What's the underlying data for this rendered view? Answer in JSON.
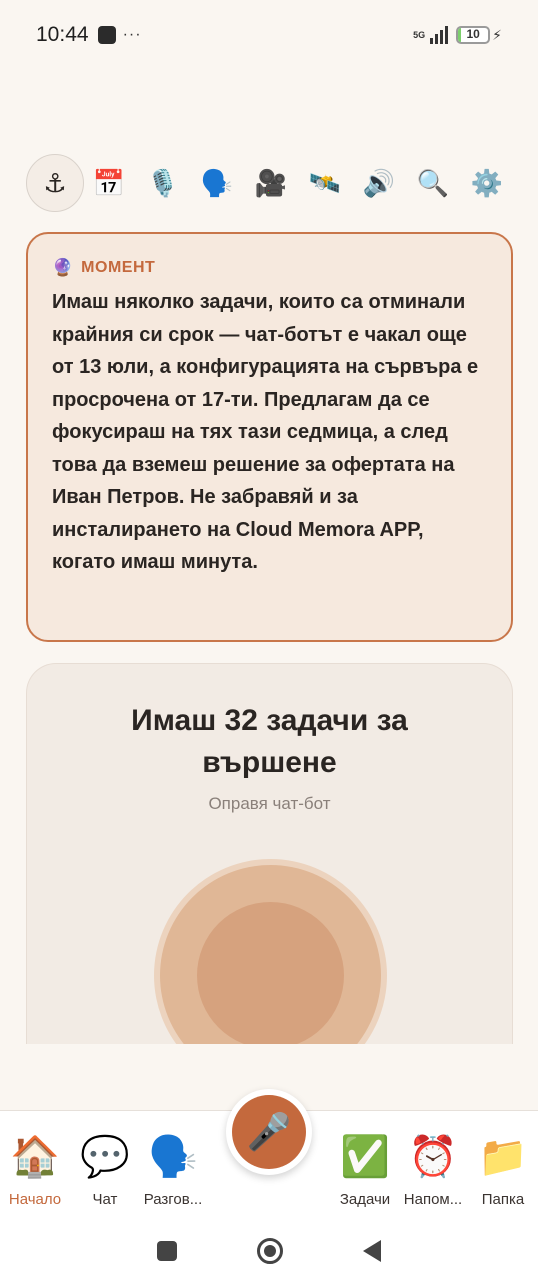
{
  "status_bar": {
    "time": "10:44",
    "dots": "···",
    "network": "5G",
    "battery": "10",
    "battery_level_percent": 10
  },
  "toolbar": {
    "icons": [
      {
        "name": "anchor-icon",
        "glyph": "⚓"
      },
      {
        "name": "calendar-icon",
        "glyph": "📅"
      },
      {
        "name": "microphone-icon",
        "glyph": "🎙️"
      },
      {
        "name": "speaking-head-icon",
        "glyph": "🗣️"
      },
      {
        "name": "movie-camera-icon",
        "glyph": "🎥"
      },
      {
        "name": "satellite-icon",
        "glyph": "🛰️"
      },
      {
        "name": "speaker-icon",
        "glyph": "🔊"
      },
      {
        "name": "magnifier-icon",
        "glyph": "🔍"
      },
      {
        "name": "gear-icon",
        "glyph": "⚙️"
      }
    ]
  },
  "moment": {
    "icon": "🔮",
    "label": "МОМЕНТ",
    "text": "Имаш няколко задачи, които са отминали крайния си срок — чат-ботът е чакал още от 13 юли, а конфигурацията на сървъра е просрочена от 17-ти. Предлагам да се фокусираш на тях тази седмица, а след това да вземеш решение за офертата на Иван Петров. Не забравяй и за инсталирането на Cloud Memora APP, когато имаш минута."
  },
  "tasks": {
    "title": "Имаш 32 задачи за вършене",
    "subtitle": "Оправя чат-бот"
  },
  "bottom_nav": {
    "items": [
      {
        "label": "Начало",
        "icon": "🏠",
        "icon_name": "house-icon"
      },
      {
        "label": "Чат",
        "icon": "💬",
        "icon_name": "speech-bubble-icon"
      },
      {
        "label": "Разгов...",
        "icon": "🗣️",
        "icon_name": "speaking-head-icon"
      },
      {
        "label": "Задачи",
        "icon": "✅",
        "icon_name": "check-mark-icon"
      },
      {
        "label": "Напом...",
        "icon": "⏰",
        "icon_name": "alarm-clock-icon"
      },
      {
        "label": "Папка",
        "icon": "📁",
        "icon_name": "folder-icon"
      }
    ],
    "mic_icon": "🎤"
  },
  "colors": {
    "accent": "#c4693d",
    "background": "#faf6f1",
    "moment_card_bg": "#f6e9de"
  }
}
